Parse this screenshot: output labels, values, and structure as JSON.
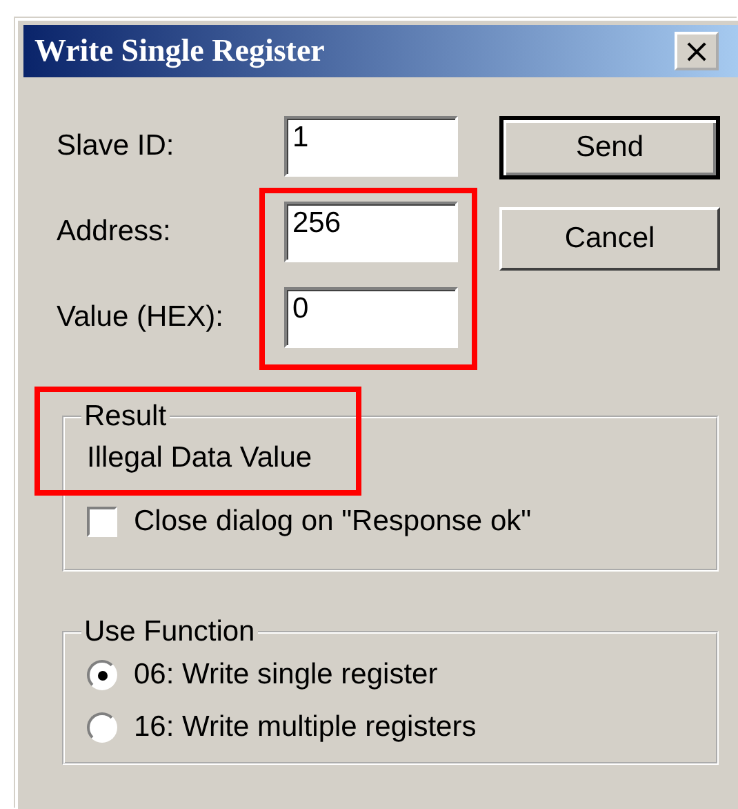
{
  "window": {
    "title": "Write Single Register",
    "close": "×"
  },
  "fields": [
    {
      "label": "Slave ID:",
      "value": "1"
    },
    {
      "label": "Address:",
      "value": "256"
    },
    {
      "label": "Value (HEX):",
      "value": "0"
    }
  ],
  "buttons": [
    {
      "label": "Send",
      "default": true
    },
    {
      "label": "Cancel",
      "default": false
    }
  ],
  "result": {
    "title": "Result",
    "message": "Illegal Data Value",
    "checkbox": {
      "label": "Close dialog on \"Response ok\"",
      "checked": false
    }
  },
  "use_function": {
    "title": "Use Function",
    "options": [
      {
        "label": "06: Write single register",
        "selected": true
      },
      {
        "label": "16: Write multiple registers",
        "selected": false
      }
    ]
  }
}
